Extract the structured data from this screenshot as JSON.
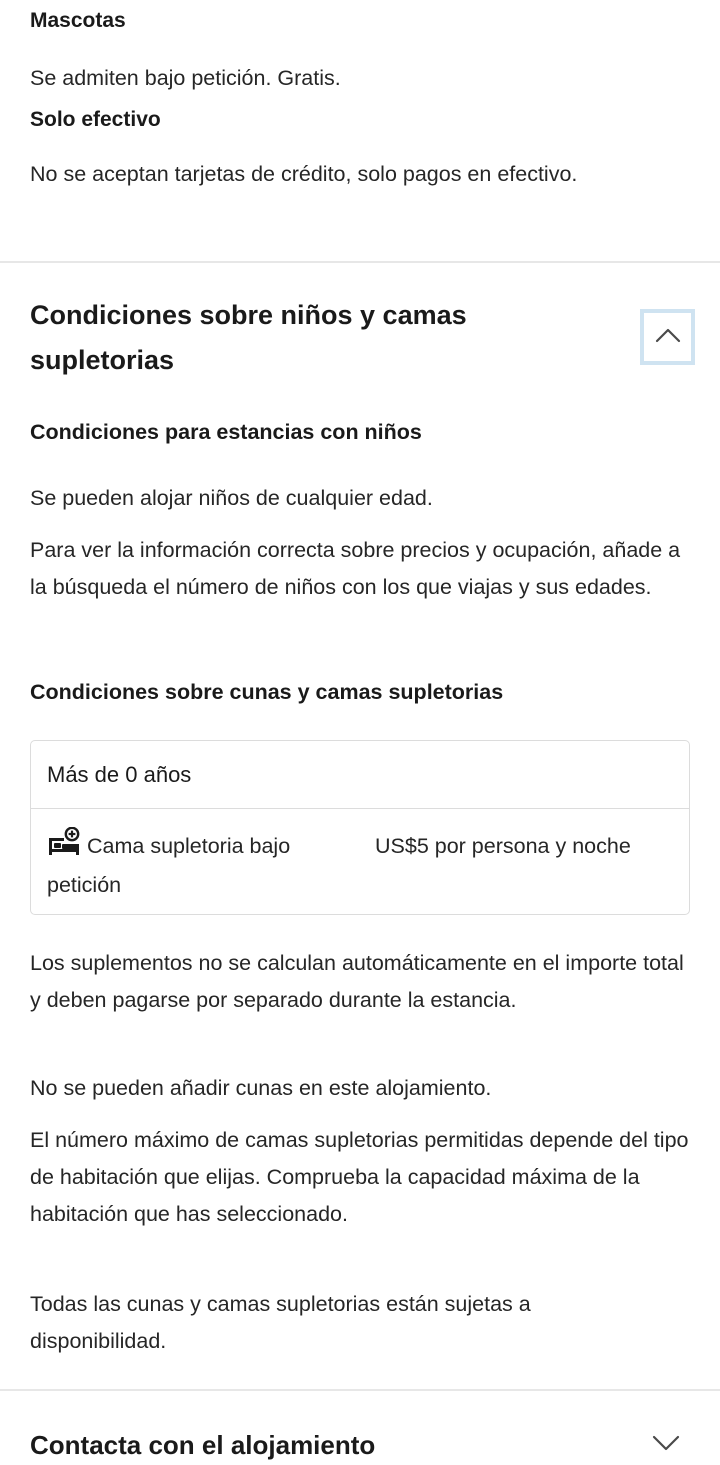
{
  "pets": {
    "title": "Mascotas",
    "text": "Se admiten bajo petición. Gratis."
  },
  "payment": {
    "title": "Solo efectivo",
    "text": "No se aceptan tarjetas de crédito, solo pagos en efectivo."
  },
  "children_section": {
    "title": "Condiciones sobre niños y camas supletorias",
    "collapse_icon": "chevron-up-icon",
    "stays_title": "Condiciones para estancias con niños",
    "stays_text_1": "Se pueden alojar niños de cualquier edad.",
    "stays_text_2": "Para ver la información correcta sobre precios y ocupación, añade a la búsqueda el número de niños con los que viajas y sus edades.",
    "beds_title": "Condiciones sobre cunas y camas supletorias",
    "table": {
      "age_header": "Más de 0 años",
      "bed_icon": "extra-bed-icon",
      "bed_label": "Cama supletoria bajo petición",
      "price": "US$5 por persona y noche"
    },
    "note_1": "Los suplementos no se calculan automáticamente en el importe total y deben pagarse por separado durante la estancia.",
    "note_2": "No se pueden añadir cunas en este alojamiento.",
    "note_3": "El número máximo de camas supletorias permitidas depende del tipo de habitación que elijas. Comprueba la capacidad máxima de la habitación que has seleccionado.",
    "note_4": "Todas las cunas y camas supletorias están sujetas a disponibilidad."
  },
  "contact_section": {
    "title": "Contacta con el alojamiento",
    "expand_icon": "chevron-down-icon"
  },
  "colors": {
    "divider": "#e7e7e7",
    "focus_ring": "#cfe3f1",
    "text": "#1a1a1a"
  }
}
